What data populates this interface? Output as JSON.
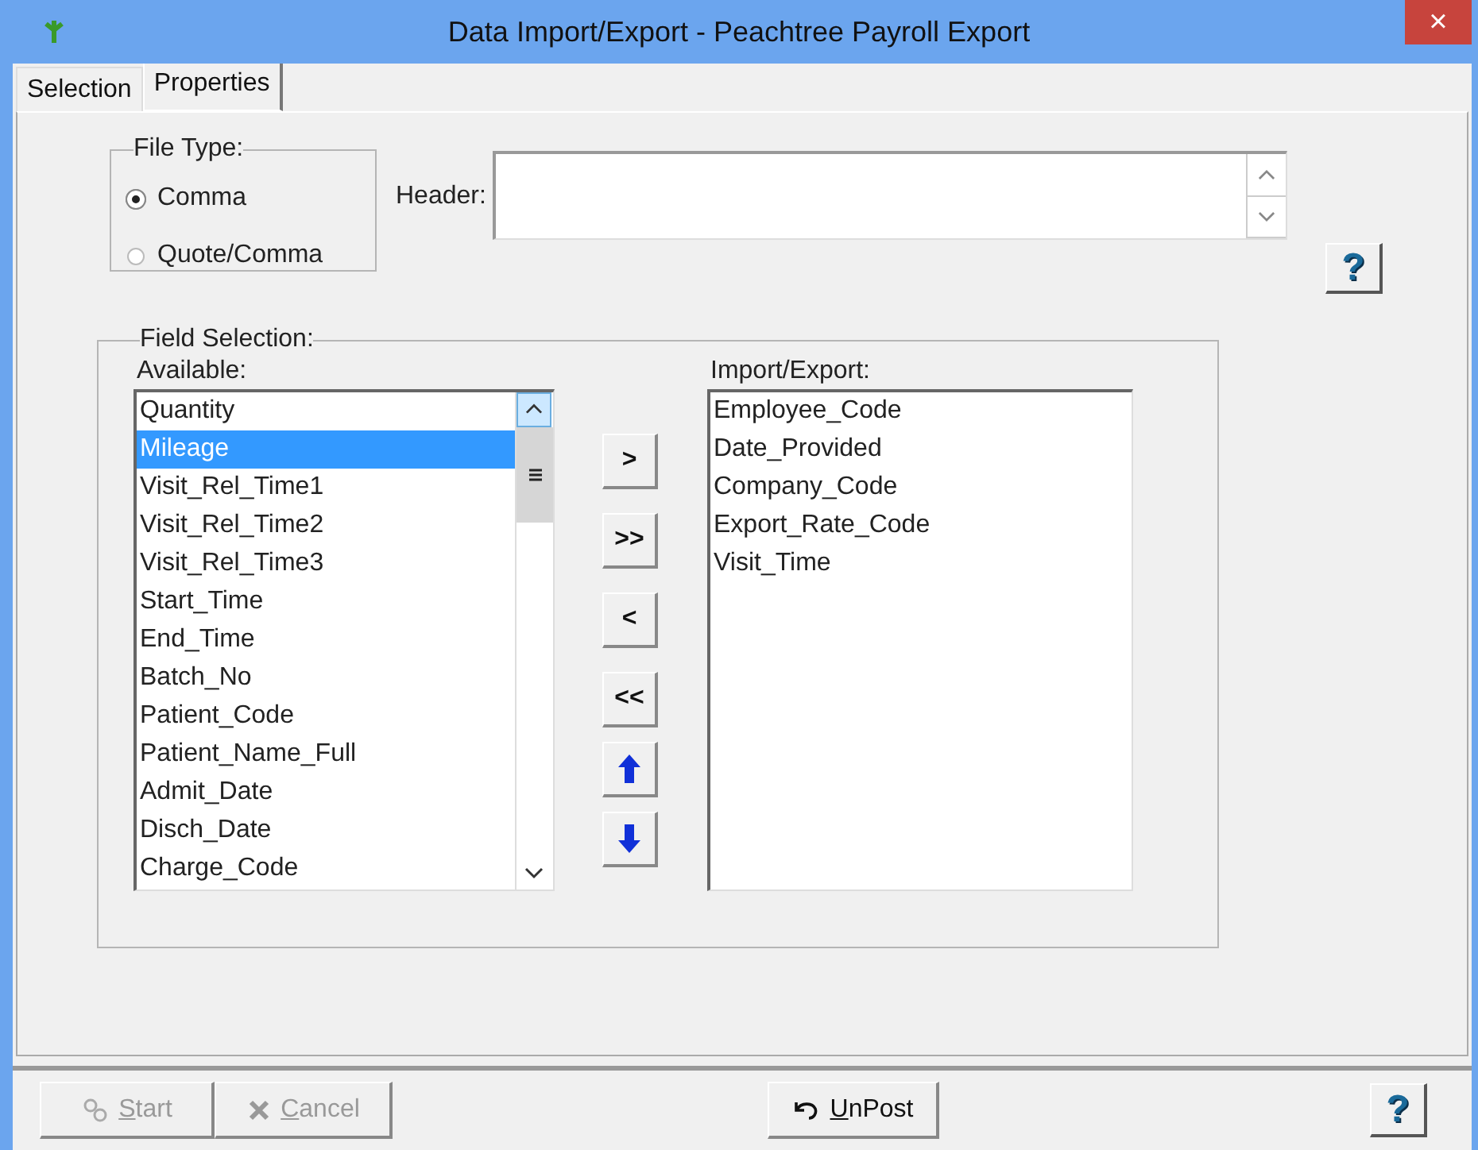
{
  "window": {
    "title": "Data Import/Export - Peachtree Payroll Export",
    "close": "×"
  },
  "tabs": [
    {
      "label": "Selection",
      "selected": false
    },
    {
      "label": "Properties",
      "selected": true
    }
  ],
  "file_type": {
    "title": "File Type:",
    "options": [
      {
        "label": "Comma",
        "selected": true
      },
      {
        "label": "Quote/Comma",
        "selected": false
      }
    ]
  },
  "header": {
    "label": "Header:"
  },
  "help_button": "?",
  "field_selection": {
    "title": "Field Selection:",
    "available": {
      "label": "Available:",
      "items": [
        {
          "label": "Quantity",
          "selected": false
        },
        {
          "label": "Mileage",
          "selected": true
        },
        {
          "label": "Visit_Rel_Time1",
          "selected": false
        },
        {
          "label": "Visit_Rel_Time2",
          "selected": false
        },
        {
          "label": "Visit_Rel_Time3",
          "selected": false
        },
        {
          "label": "Start_Time",
          "selected": false
        },
        {
          "label": "End_Time",
          "selected": false
        },
        {
          "label": "Batch_No",
          "selected": false
        },
        {
          "label": "Patient_Code",
          "selected": false
        },
        {
          "label": "Patient_Name_Full",
          "selected": false
        },
        {
          "label": "Admit_Date",
          "selected": false
        },
        {
          "label": "Disch_Date",
          "selected": false
        },
        {
          "label": "Charge_Code",
          "selected": false
        }
      ]
    },
    "move_buttons": [
      {
        "kind": "text",
        "label": ">"
      },
      {
        "kind": "text",
        "label": ">>"
      },
      {
        "kind": "text",
        "label": "<"
      },
      {
        "kind": "text",
        "label": "<<"
      },
      {
        "kind": "up"
      },
      {
        "kind": "down"
      }
    ],
    "import_export": {
      "label": "Import/Export:",
      "items": [
        "Employee_Code",
        "Date_Provided",
        "Company_Code",
        "Export_Rate_Code",
        "Visit_Time"
      ]
    }
  },
  "footer": {
    "buttons": [
      {
        "kind": "start",
        "label": "Start",
        "disabled": true
      },
      {
        "kind": "cancel",
        "label": "Cancel",
        "disabled": true
      },
      {
        "kind": "unpost",
        "label": "UnPost",
        "disabled": false
      }
    ],
    "help": "?"
  }
}
